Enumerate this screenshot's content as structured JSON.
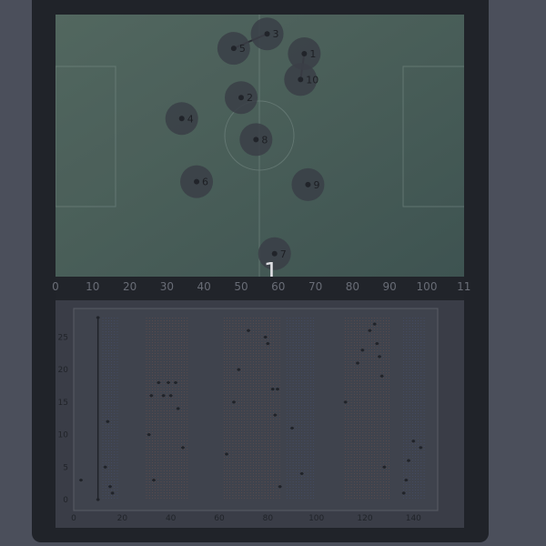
{
  "page_indicator": "1",
  "pitch": {
    "players": [
      {
        "label": "1",
        "x": 67,
        "y": 4.7
      },
      {
        "label": "3",
        "x": 57,
        "y": 1.4
      },
      {
        "label": "5",
        "x": 48,
        "y": 3.8
      },
      {
        "label": "10",
        "x": 66,
        "y": 9
      },
      {
        "label": "2",
        "x": 50,
        "y": 12
      },
      {
        "label": "4",
        "x": 34,
        "y": 15.5
      },
      {
        "label": "8",
        "x": 54,
        "y": 19
      },
      {
        "label": "6",
        "x": 38,
        "y": 26
      },
      {
        "label": "9",
        "x": 68,
        "y": 26.5
      },
      {
        "label": "7",
        "x": 59,
        "y": 38
      }
    ],
    "links": [
      [
        "1",
        "10"
      ],
      [
        "5",
        "3"
      ]
    ],
    "x_ticks": [
      "0",
      "10",
      "20",
      "30",
      "40",
      "50",
      "60",
      "70",
      "80",
      "90",
      "100",
      "11"
    ]
  },
  "chart_data": {
    "type": "scatter",
    "title": "",
    "xlabel": "",
    "ylabel": "",
    "xlim": [
      0,
      150
    ],
    "ylim": [
      0,
      28
    ],
    "x_ticks": [
      "0",
      "20",
      "40",
      "60",
      "80",
      "100",
      "120",
      "140"
    ],
    "y_ticks": [
      "0",
      "5",
      "10",
      "15",
      "20",
      "25"
    ],
    "series": [
      {
        "values": [
          [
            3,
            3
          ],
          [
            10,
            28
          ],
          [
            10,
            0
          ],
          [
            13,
            5
          ],
          [
            14,
            12
          ],
          [
            15,
            2
          ],
          [
            16,
            1
          ],
          [
            31,
            10
          ],
          [
            32,
            16
          ],
          [
            33,
            3
          ],
          [
            35,
            18
          ],
          [
            37,
            16
          ],
          [
            39,
            18
          ],
          [
            40,
            16
          ],
          [
            42,
            18
          ],
          [
            43,
            14
          ],
          [
            45,
            8
          ],
          [
            63,
            7
          ],
          [
            66,
            15
          ],
          [
            68,
            20
          ],
          [
            72,
            26
          ],
          [
            79,
            25
          ],
          [
            80,
            24
          ],
          [
            82,
            17
          ],
          [
            83,
            13
          ],
          [
            84,
            17
          ],
          [
            85,
            2
          ],
          [
            90,
            11
          ],
          [
            94,
            4
          ],
          [
            112,
            15
          ],
          [
            117,
            21
          ],
          [
            119,
            23
          ],
          [
            122,
            26
          ],
          [
            124,
            27
          ],
          [
            125,
            24
          ],
          [
            126,
            22
          ],
          [
            127,
            19
          ],
          [
            128,
            5
          ],
          [
            136,
            1
          ],
          [
            137,
            3
          ],
          [
            138,
            6
          ],
          [
            140,
            9
          ],
          [
            143,
            8
          ]
        ]
      }
    ]
  }
}
